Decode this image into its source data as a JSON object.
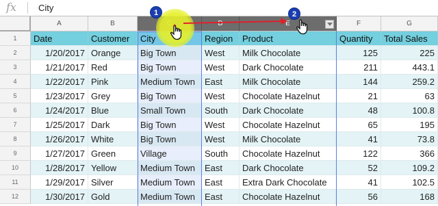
{
  "formula_bar": {
    "fx_label": "fx",
    "value": "City"
  },
  "columns": [
    "A",
    "B",
    "C",
    "D",
    "E",
    "F",
    "G"
  ],
  "header_row": [
    "Date",
    "Customer",
    "City",
    "Region",
    "Product",
    "Quantity",
    "Total Sales"
  ],
  "row_numbers": [
    "1",
    "2",
    "3",
    "4",
    "5",
    "6",
    "7",
    "8",
    "9",
    "10",
    "11",
    "12"
  ],
  "rows": [
    [
      "1/20/2017",
      "Orange",
      "Big Town",
      "West",
      "Milk Chocolate",
      "125",
      "225"
    ],
    [
      "1/21/2017",
      "Red",
      "Big Town",
      "West",
      "Dark Chocolate",
      "211",
      "443.1"
    ],
    [
      "1/22/2017",
      "Pink",
      "Medium Town",
      "East",
      "Milk Chocolate",
      "144",
      "259.2"
    ],
    [
      "1/23/2017",
      "Grey",
      "Big Town",
      "West",
      "Chocolate Hazelnut",
      "21",
      "63"
    ],
    [
      "1/24/2017",
      "Blue",
      "Small Town",
      "South",
      "Dark Chocolate",
      "48",
      "100.8"
    ],
    [
      "1/25/2017",
      "Dark",
      "Big Town",
      "West",
      "Chocolate Hazelnut",
      "65",
      "195"
    ],
    [
      "1/26/2017",
      "White",
      "Big Town",
      "West",
      "Milk Chocolate",
      "41",
      "73.8"
    ],
    [
      "1/27/2017",
      "Green",
      "Village",
      "South",
      "Chocolate Hazelnut",
      "122",
      "366"
    ],
    [
      "1/28/2017",
      "Yellow",
      "Medium Town",
      "East",
      "Dark Chocolate",
      "52",
      "109.2"
    ],
    [
      "1/29/2017",
      "Silver",
      "Medium Town",
      "East",
      "Extra Dark Chocolate",
      "41",
      "102.5"
    ],
    [
      "1/30/2017",
      "Gold",
      "Medium Town",
      "East",
      "Chocolate Hazelnut",
      "56",
      "168"
    ]
  ],
  "annotations": {
    "step1": "1",
    "step2": "2"
  },
  "colors": {
    "header_fill": "#74cfde",
    "band_fill": "#e3f3f6",
    "badge": "#1b3fb0",
    "arrow": "#e0202a",
    "halo": "#e6f028"
  }
}
